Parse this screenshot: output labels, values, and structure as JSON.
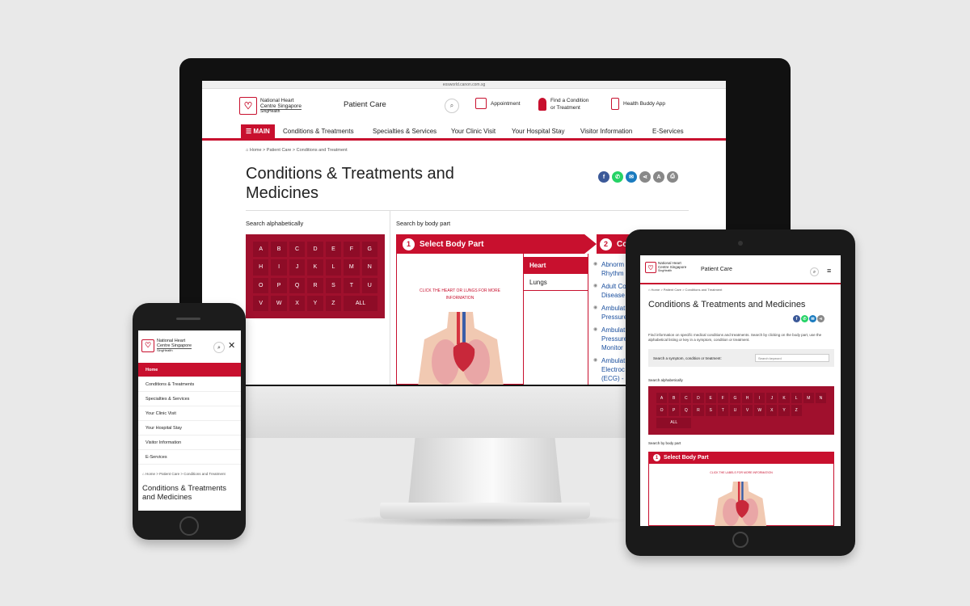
{
  "desktop": {
    "url": "eosworld.canon.com.sg",
    "logo": {
      "line1": "National Heart",
      "line2": "Centre Singapore",
      "line3": "SingHealth"
    },
    "section_title": "Patient Care",
    "header_links": {
      "appointment": "Appointment",
      "find1": "Find a Condition",
      "find2": "or Treatment",
      "app": "Health Buddy App"
    },
    "nav": {
      "main": "☰ MAIN",
      "items": [
        "Conditions & Treatments",
        "Specialties & Services",
        "Your Clinic Visit",
        "Your Hospital Stay",
        "Visitor Information",
        "E-Services"
      ]
    },
    "breadcrumb": "Home > Patient Care > Conditions and Treatment",
    "title_line1": "Conditions & Treatments and",
    "title_line2": "Medicines",
    "search_alpha_label": "Search alphabetically",
    "search_body_label": "Search by body part",
    "letters": [
      "A",
      "B",
      "C",
      "D",
      "E",
      "F",
      "G",
      "H",
      "I",
      "J",
      "K",
      "L",
      "M",
      "N",
      "O",
      "P",
      "Q",
      "R",
      "S",
      "T",
      "U",
      "V",
      "W",
      "X",
      "Y",
      "Z",
      "ALL"
    ],
    "step1": {
      "num": "1",
      "label": "Select Body Part"
    },
    "step2": {
      "num": "2",
      "label": "Co"
    },
    "click_hint1": "CLICK THE HEART OR LUNGS FOR MORE",
    "click_hint2": "INFORMATION",
    "parts": [
      "Heart",
      "Lungs"
    ],
    "conditions": [
      "Abnorm",
      "Rhythm",
      "Adult Co",
      "Disease",
      "Ambulat",
      "Pressure",
      "Ambulat",
      "Pressure",
      "Monitor",
      "Ambulat",
      "Electroc",
      "(ECG) - H"
    ]
  },
  "tablet": {
    "logo": {
      "line1": "National Heart",
      "line2": "Centre Singapore",
      "line3": "SingHealth"
    },
    "section_title": "Patient Care",
    "breadcrumb": "Home > Patient Care > Conditions and Treatment",
    "title": "Conditions & Treatments and Medicines",
    "intro": "Find information on specific medical conditions and treatments. Search by clicking on the body part, use the alphabetical listing or key in a symptom, condition or treatment.",
    "search_label": "Search a symptom, condition or treatment:",
    "search_placeholder": "Search keyword",
    "search_alpha_label": "Search alphabetically",
    "letters": [
      "A",
      "B",
      "C",
      "D",
      "E",
      "F",
      "G",
      "H",
      "I",
      "J",
      "K",
      "L",
      "M",
      "N",
      "O",
      "P",
      "Q",
      "R",
      "S",
      "T",
      "U",
      "V",
      "W",
      "X",
      "Y",
      "Z",
      "ALL"
    ],
    "search_body_label": "Search by body part",
    "step1": {
      "num": "1",
      "label": "Select Body Part"
    },
    "click_hint": "CLICK THE LABELS FOR MORE INFORMATION"
  },
  "phone": {
    "logo": {
      "line1": "National Heart",
      "line2": "Centre Singapore",
      "line3": "SingHealth"
    },
    "menu": [
      "Home",
      "Conditions & Treatments",
      "Specialties & Services",
      "Your Clinic Visit",
      "Your Hospital Stay",
      "Visitor Information",
      "E-Services"
    ],
    "breadcrumb": "Home > Patient Care > Conditions and Treatment",
    "title_line1": "Conditions & Treatments",
    "title_line2": "and Medicines"
  },
  "colors": {
    "brand": "#c8102e",
    "alpha_bg": "#a0102d",
    "link": "#1a4f9e"
  },
  "share_icons": [
    "facebook-icon",
    "whatsapp-icon",
    "email-icon",
    "share-icon",
    "font-size-icon",
    "print-icon"
  ]
}
